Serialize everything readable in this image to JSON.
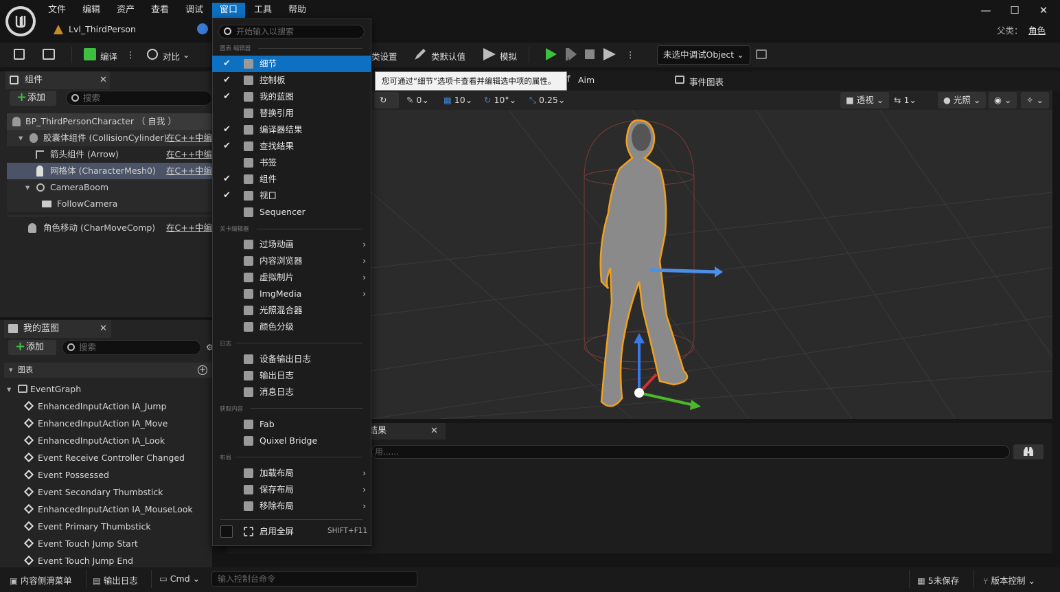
{
  "menu_bar": [
    "文件",
    "编辑",
    "资产",
    "查看",
    "调试",
    "窗口",
    "工具",
    "帮助"
  ],
  "document_tab": "Lvl_ThirdPerson",
  "parent": {
    "label": "父类：",
    "value": "角色"
  },
  "toolbar": {
    "compile": "编译",
    "diff": "对比",
    "class_settings": "类设置",
    "class_defaults": "类默认值",
    "simulate": "模拟",
    "debug_object": "未选中调试Object"
  },
  "tabs_row": {
    "aim": "Aim",
    "event_graph": "事件图表"
  },
  "components_panel": {
    "title": "组件",
    "add": "添加",
    "search_placeholder": "搜索",
    "rows": [
      {
        "name": "BP_ThirdPersonCharacter （ 自我 ）",
        "link": ""
      },
      {
        "name": "胶囊体组件 (CollisionCylinder)",
        "link": "在C++中编辑"
      },
      {
        "name": "箭头组件 (Arrow)",
        "link": "在C++中编辑"
      },
      {
        "name": "网格体 (CharacterMesh0)",
        "link": "在C++中编辑"
      },
      {
        "name": "CameraBoom",
        "link": ""
      },
      {
        "name": "FollowCamera",
        "link": ""
      },
      {
        "name": "角色移动 (CharMoveComp)",
        "link": "在C++中编辑"
      }
    ]
  },
  "my_blueprint_panel": {
    "title": "我的蓝图",
    "add": "添加",
    "search_placeholder": "搜索",
    "graphs_header": "图表",
    "event_graph": "EventGraph",
    "events": [
      "EnhancedInputAction IA_Jump",
      "EnhancedInputAction IA_Move",
      "EnhancedInputAction IA_Look",
      "Event Receive Controller Changed",
      "Event Possessed",
      "Event Secondary Thumbstick",
      "EnhancedInputAction IA_MouseLook",
      "Event Primary Thumbstick",
      "Event Touch Jump Start",
      "Event Touch Jump End"
    ]
  },
  "viewport": {
    "rot": "0",
    "grid": "10",
    "angle": "10°",
    "scale": "0.25",
    "perspective": "透视",
    "speed": "1",
    "lighting": "光照"
  },
  "find_results": {
    "tab": "结果",
    "placeholder": "用......"
  },
  "status_bar": {
    "content_drawer": "内容侧滑菜单",
    "output_log": "输出日志",
    "cmd": "Cmd",
    "console_placeholder": "输入控制台命令",
    "unsaved": "5未保存",
    "source_control": "版本控制"
  },
  "window_menu": {
    "search_placeholder": "开始输入以搜索",
    "sections": {
      "graph_editor": "图表 编辑器",
      "level_editor": "关卡编辑器",
      "log": "日志",
      "get_content": "获取内容",
      "layout": "布局"
    },
    "graph_items": [
      {
        "label": "细节",
        "checked": true
      },
      {
        "label": "控制板",
        "checked": true
      },
      {
        "label": "我的蓝图",
        "checked": true
      },
      {
        "label": "替换引用",
        "checked": false
      },
      {
        "label": "编译器结果",
        "checked": true
      },
      {
        "label": "查找结果",
        "checked": true
      },
      {
        "label": "书签",
        "checked": false
      },
      {
        "label": "组件",
        "checked": true
      },
      {
        "label": "视口",
        "checked": true
      },
      {
        "label": "Sequencer",
        "checked": false
      }
    ],
    "level_items": [
      "过场动画",
      "内容浏览器",
      "虚拟制片",
      "ImgMedia",
      "光照混合器",
      "颜色分级"
    ],
    "log_items": [
      "设备输出日志",
      "输出日志",
      "消息日志"
    ],
    "content_items": [
      "Fab",
      "Quixel Bridge"
    ],
    "layout_items": [
      "加载布局",
      "保存布局",
      "移除布局"
    ],
    "fullscreen": {
      "label": "启用全屏",
      "shortcut": "SHIFT+F11"
    },
    "tooltip": "您可通过“细节”选项卡查看并编辑选中项的属性。"
  },
  "colors": {
    "accent": "#0e70c0",
    "play": "#3fbf3f"
  }
}
